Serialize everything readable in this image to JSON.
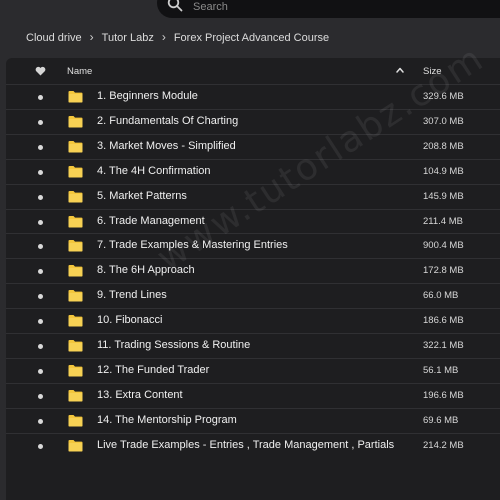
{
  "search": {
    "placeholder": "Search"
  },
  "breadcrumb": [
    "Cloud drive",
    "Tutor Labz",
    "Forex Project Advanced Course"
  ],
  "header": {
    "name_label": "Name",
    "size_label": "Size"
  },
  "files": [
    {
      "name": "1. Beginners Module",
      "size": "329.6 MB"
    },
    {
      "name": "2. Fundamentals Of Charting",
      "size": "307.0 MB"
    },
    {
      "name": "3. Market Moves - Simplified",
      "size": "208.8 MB"
    },
    {
      "name": "4. The 4H Confirmation",
      "size": "104.9 MB"
    },
    {
      "name": "5. Market Patterns",
      "size": "145.9 MB"
    },
    {
      "name": "6. Trade Management",
      "size": "211.4 MB"
    },
    {
      "name": "7. Trade Examples & Mastering Entries",
      "size": "900.4 MB"
    },
    {
      "name": "8. The 6H Approach",
      "size": "172.8 MB"
    },
    {
      "name": "9. Trend Lines",
      "size": "66.0 MB"
    },
    {
      "name": "10. Fibonacci",
      "size": "186.6 MB"
    },
    {
      "name": "11. Trading Sessions & Routine",
      "size": "322.1 MB"
    },
    {
      "name": "12. The Funded Trader",
      "size": "56.1 MB"
    },
    {
      "name": "13. Extra Content",
      "size": "196.6 MB"
    },
    {
      "name": "14. The Mentorship Program",
      "size": "69.6 MB"
    },
    {
      "name": "Live Trade Examples - Entries , Trade Management , Partials",
      "size": "214.2 MB"
    }
  ],
  "watermark": "www.tutorlabz.com",
  "colors": {
    "folder": "#f3c63c",
    "background": "#1e1e20",
    "topbar": "#2b2b2e"
  },
  "icons": {
    "search": "search-icon",
    "favorite": "heart-icon",
    "sort": "chevron-up-icon",
    "folder": "folder-icon",
    "separator": "chevron-right-icon"
  }
}
